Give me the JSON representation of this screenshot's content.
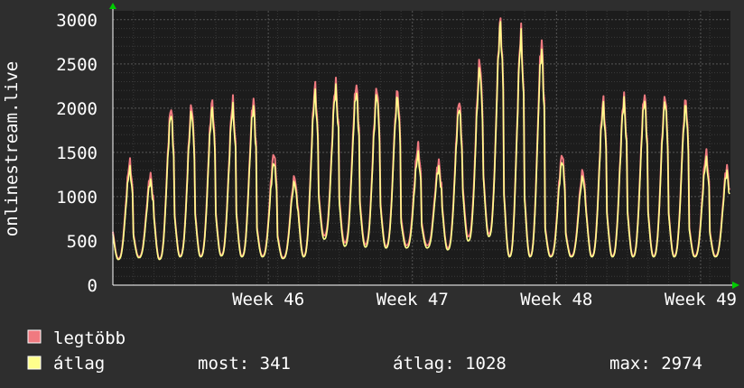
{
  "chart_data": {
    "type": "line",
    "ylabel": "onlinestream.live",
    "ylim": [
      0,
      3100
    ],
    "yticks": [
      0,
      500,
      1000,
      1500,
      2000,
      2500,
      3000
    ],
    "ytick_labels": [
      "0",
      "500",
      "1000",
      "1500",
      "2000",
      "2500",
      "3000"
    ],
    "xticks": [
      {
        "label": "Week 46",
        "day": 7.55
      },
      {
        "label": "Week 47",
        "day": 14.55
      },
      {
        "label": "Week 48",
        "day": 21.55
      },
      {
        "label": "Week 49",
        "day": 28.55
      }
    ],
    "grid": true,
    "legend_placement": "bottom-left",
    "colors": {
      "background": "#2e2e2e",
      "plot_background": "#1c1c1c",
      "grid": "#555555",
      "minor_grid": "#3a3a3a",
      "axis": "#ffffff",
      "arrow": "#00cc00"
    },
    "series": [
      {
        "name": "legtöbb",
        "color": "#f07a80",
        "day_peaks": [
          1400,
          1250,
          2020,
          2040,
          2080,
          2090,
          2100,
          1500,
          1230,
          2260,
          2290,
          2280,
          2240,
          2200,
          1580,
          1400,
          2100,
          2550,
          3000,
          2880,
          2760,
          1490,
          1300,
          2100,
          2130,
          2170,
          2150,
          2100,
          1500,
          1340
        ],
        "day_troughs": [
          300,
          320,
          300,
          330,
          330,
          340,
          330,
          330,
          310,
          330,
          560,
          480,
          460,
          440,
          450,
          450,
          420,
          550,
          580,
          330,
          330,
          330,
          330,
          330,
          330,
          330,
          330,
          330,
          330,
          330
        ]
      },
      {
        "name": "átlag",
        "color": "#ffff8c",
        "day_peaks": [
          1320,
          1180,
          1950,
          1970,
          2000,
          2010,
          2020,
          1400,
          1170,
          2180,
          2220,
          2190,
          2170,
          2130,
          1480,
          1330,
          2020,
          2460,
          2960,
          2820,
          2660,
          1410,
          1230,
          2040,
          2080,
          2100,
          2090,
          2040,
          1420,
          1280
        ],
        "day_troughs": [
          290,
          310,
          290,
          320,
          320,
          330,
          320,
          320,
          300,
          320,
          520,
          440,
          430,
          420,
          420,
          420,
          400,
          500,
          550,
          320,
          320,
          320,
          320,
          320,
          320,
          320,
          320,
          320,
          320,
          320
        ]
      }
    ],
    "days_span": 30
  },
  "legend": {
    "max_label": "legtöbb",
    "avg_label": "átlag"
  },
  "stats": {
    "most": "most: 341",
    "atlag": "átlag: 1028",
    "max": "max: 2974"
  }
}
